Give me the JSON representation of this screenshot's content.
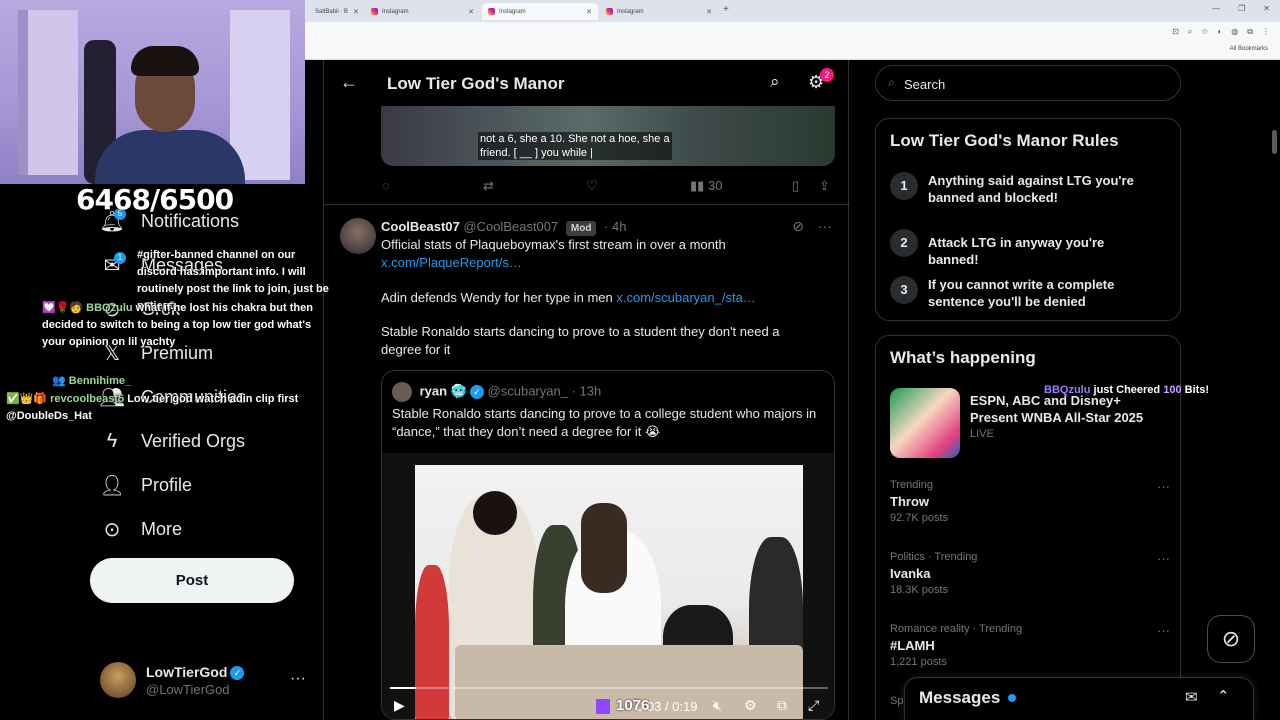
{
  "browser": {
    "tabs": [
      {
        "title": "SaltBabii · B",
        "active": false
      },
      {
        "title": "Instagram",
        "active": false
      },
      {
        "title": "Instagram",
        "active": true
      },
      {
        "title": "Instagram",
        "active": false
      }
    ],
    "all_bookmarks": "All Bookmarks"
  },
  "stream": {
    "score": "6468/6500",
    "viewers": "1076"
  },
  "nav": {
    "notifications": "Notifications",
    "notifications_badge": "5",
    "messages": "Messages",
    "messages_badge": "1",
    "grok": "Grok",
    "premium": "Premium",
    "communities": "Communities",
    "verified_orgs": "Verified Orgs",
    "profile": "Profile",
    "more": "More",
    "post": "Post",
    "account_name": "LowTierGod",
    "account_handle": "@LowTierGod"
  },
  "chat": [
    {
      "user": "",
      "text": "#gifter-banned channel on our discord has important info. I will routinely post the link to join, just be patient."
    },
    {
      "user": "BBQzulu",
      "text": "what if he lost his chakra but then decided to switch to being a top low tier god what's your opinion on lil yachty"
    },
    {
      "user": "Bennihime_",
      "text": ""
    },
    {
      "user": "revcoolbeast5",
      "text": "Low tier god watch adin clip first @DoubleDs_Hat"
    }
  ],
  "header": {
    "title": "Low Tier God's Manor",
    "settings_badge": "2"
  },
  "prev_post": {
    "caption_line1": "not a 6, she a 10. She not a hoe, she a",
    "caption_line2": "friend. [ __ ] you while |",
    "views": "30"
  },
  "post": {
    "name": "CoolBeast07",
    "handle": "@CoolBeast007",
    "badge": "Mod",
    "time": "4h",
    "p1": "Official stats of Plaqueboymax's first stream in over a month",
    "p1_link": "x.com/PlaqueReport/s…",
    "p2": "Adin defends Wendy for her type in men",
    "p2_link": "x.com/scubaryan_/sta…",
    "p3": "Stable Ronaldo starts dancing to prove to a student they don't need a degree for it"
  },
  "quote": {
    "name": "ryan",
    "handle": "@scubaryan_",
    "time": "13h",
    "text": "Stable Ronaldo starts dancing to prove to a college student who majors in “dance,” that they don’t need a degree for it 😭",
    "video_time": "0:03 / 0:19",
    "progress": 0.06
  },
  "right": {
    "search_placeholder": "Search",
    "rules_title": "Low Tier God's Manor Rules",
    "rules": [
      {
        "num": "1",
        "text": "Anything said against LTG you're banned and blocked!"
      },
      {
        "num": "2",
        "text": "Attack LTG in anyway you're banned!"
      },
      {
        "num": "3",
        "text": "If you cannot write a complete sentence you'll be denied"
      }
    ],
    "happening_title": "What’s happening",
    "happening_item": "ESPN, ABC and Disney+ Present WNBA All-Star 2025",
    "happening_live": "LIVE",
    "trends": [
      {
        "cat": "Trending",
        "name": "Throw",
        "count": "92.7K posts"
      },
      {
        "cat": "Politics · Trending",
        "name": "Ivanka",
        "count": "18.3K posts"
      },
      {
        "cat": "Romance reality · Trending",
        "name": "#LAMH",
        "count": "1,221 posts"
      }
    ],
    "trend_partial": "Spo",
    "cheer_user": "BBQzulu",
    "cheer_text": "just Cheered",
    "cheer_bits": "100",
    "cheer_suffix": "Bits!",
    "messages": "Messages"
  }
}
